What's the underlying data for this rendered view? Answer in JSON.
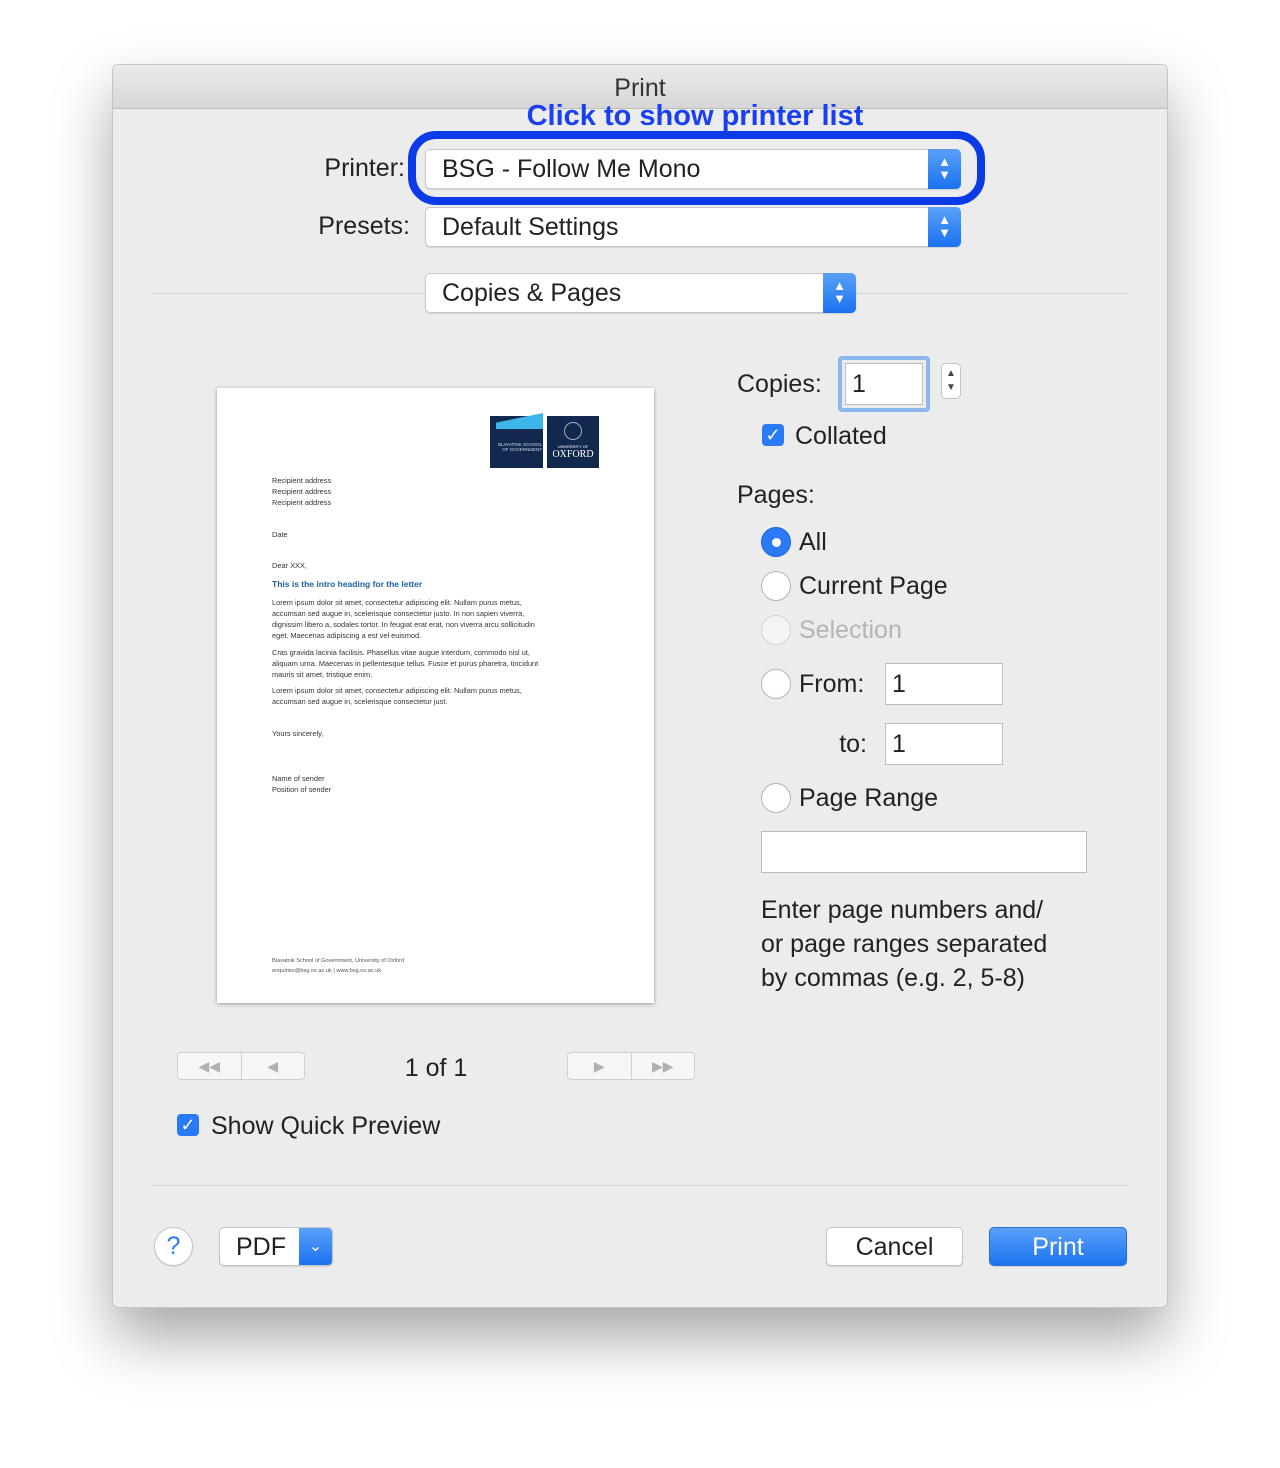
{
  "window": {
    "title": "Print"
  },
  "annotation": {
    "text": "Click to show printer list",
    "color": "#1a3ff0"
  },
  "printer": {
    "label": "Printer:",
    "value": "BSG - Follow Me Mono"
  },
  "presets": {
    "label": "Presets:",
    "value": "Default Settings"
  },
  "section": {
    "value": "Copies & Pages"
  },
  "preview": {
    "logo": {
      "left": "BLAVATNIK SCHOOL OF GOVERNMENT",
      "right_small": "UNIVERSITY OF",
      "right": "OXFORD"
    },
    "address": [
      "Recipient address",
      "Recipient address",
      "Recipient address"
    ],
    "date": "Date",
    "salutation": "Dear XXX,",
    "heading": "This is the intro heading for the letter",
    "paragraphs": [
      [
        "Lorem ipsum dolor sit amet, consectetur adipiscing elit. Nullam purus metus,",
        "accumsan sed augue in, scelerisque consectetur justo. In non sapien viverra,",
        "dignissim libero a, sodales tortor. In feugiat erat erat, non viverra arcu sollicitudin",
        "eget. Maecenas adipiscing a est vel euismod."
      ],
      [
        "Cras gravida lacinia facilisis. Phasellus vitae augue interdum, commodo nisl ut,",
        "aliquam urna. Maecenas in pellentesque tellus. Fusce et purus pharetra, tincidunt",
        "mauris sit amet, tristique enim."
      ],
      [
        "Lorem ipsum dolor sit amet, consectetur adipiscing elit. Nullam purus metus,",
        "accumsan sed augue in, scelerisque consectetur just."
      ]
    ],
    "closing": "Yours sincerely,",
    "sender": [
      "Name of sender",
      "Position of sender"
    ],
    "footer": [
      "Blavatnik School of Government, University of Oxford",
      "enquiries@bsg.ox.ac.uk  |  www.bsg.ox.ac.uk"
    ]
  },
  "pager": {
    "text": "1 of 1"
  },
  "quick_preview": {
    "label": "Show Quick Preview",
    "checked": true
  },
  "copies": {
    "label": "Copies:",
    "value": "1"
  },
  "collated": {
    "label": "Collated",
    "checked": true
  },
  "pages": {
    "label": "Pages:",
    "all": "All",
    "current": "Current Page",
    "selection": "Selection",
    "from_label": "From:",
    "from_value": "1",
    "to_label": "to:",
    "to_value": "1",
    "range_label": "Page Range",
    "range_value": "",
    "selected": "All",
    "help": [
      "Enter page numbers and/",
      "or page ranges separated",
      "by commas (e.g. 2, 5-8)"
    ]
  },
  "buttons": {
    "help": "?",
    "pdf": "PDF",
    "cancel": "Cancel",
    "print": "Print"
  },
  "colors": {
    "accent": "#2a7af5"
  }
}
